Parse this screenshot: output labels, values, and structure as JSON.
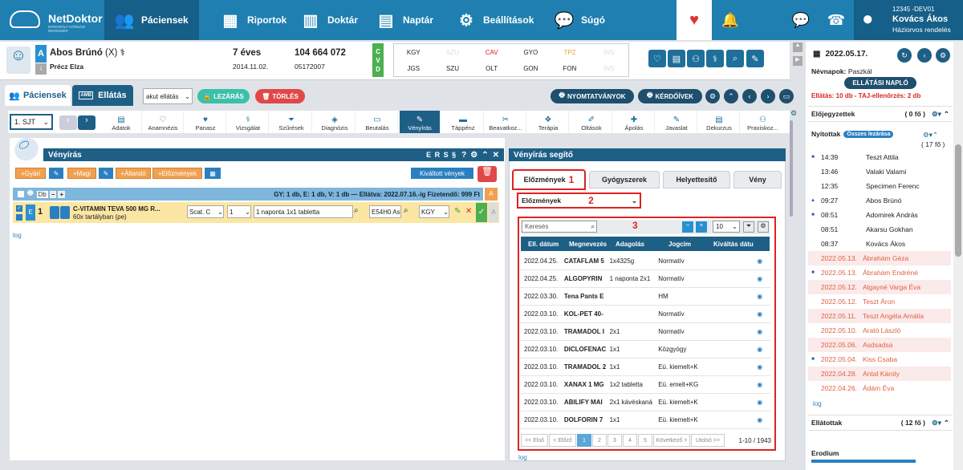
{
  "nav": {
    "logo_name": "NetDoktor",
    "logo_sub": "INTEGRÁLT KÓRHÁZI RENDSZER",
    "items": [
      {
        "label": "Páciensek"
      },
      {
        "label": "Riportok"
      },
      {
        "label": "Doktár"
      },
      {
        "label": "Naptár"
      },
      {
        "label": "Beállítások"
      },
      {
        "label": "Súgó"
      }
    ],
    "user": {
      "code": "12345 -DEV01",
      "name": "Kovács Ákos",
      "role": "Háziorvos rendelés"
    }
  },
  "patient": {
    "letter": "A",
    "name": "Abos Brúnó",
    "suffix": "(X)",
    "mother": "Précz Elza",
    "age": "7 éves",
    "birth": "2014.11.02.",
    "taj": "104 664 072",
    "id": "05172007",
    "cvd": [
      "C",
      "V",
      "D"
    ],
    "codes": [
      "KGY",
      "SZU",
      "CAV",
      "GYO",
      "TPZ",
      "INS",
      "JGS",
      "SZU",
      "OLT",
      "GON",
      "FON",
      "INS"
    ]
  },
  "tabs": {
    "patients": "Páciensek",
    "ellatas": "Ellátás",
    "amb": "AMB",
    "care_select": "akut ellátás",
    "close": "LEZÁRÁS",
    "delete": "TÖRLÉS",
    "print": "NYOMTATVÁNYOK",
    "questionnaires": "KÉRDŐÍVEK"
  },
  "modules": {
    "sjt": "1. SJT",
    "items": [
      "Adatok",
      "Anamnézis",
      "Panasz",
      "Vizsgálat",
      "Szűrések",
      "Diagnózis",
      "Beutalás",
      "Vényírás",
      "Táppénz",
      "Beavatkoz...",
      "Terápia",
      "Oltások",
      "Ápolás",
      "Javaslat",
      "Dekurzus",
      "Praxiskoz..."
    ]
  },
  "prescription": {
    "title": "Vényírás",
    "header_icons": "E   R   S   §",
    "buttons": [
      "+Gyári",
      "+Magi",
      "+Állandó",
      "+Előzmények"
    ],
    "issued": "Kiváltott vények",
    "summary": "GY: 1 db,  E: 1 db,  V: 1 db  —  Ellátva: 2022.07.16.-ig  Fizetendő: 999 Ft",
    "db": "Db",
    "row": {
      "num": "1",
      "name": "C-VITAMIN TEVA 500 MG R...",
      "pack": "60x tartályban (pe)",
      "category": "Scat. C",
      "qty": "1",
      "dose": "1 naponta 1x1 tabletta",
      "bno": "E54H0 As",
      "support": "KGY"
    },
    "log": "log"
  },
  "helper": {
    "title": "Vényírás segítő",
    "tabs": [
      "Előzmények",
      "Gyógyszerek",
      "Helyettesítő",
      "Vény"
    ],
    "select": "Előzmények",
    "marks": [
      "1",
      "2",
      "3"
    ],
    "search_placeholder": "Keresés",
    "per_page": "10",
    "columns": [
      "Ell. dátum",
      "Megnevezés",
      "Adagolás",
      "Jogcím",
      "Kiváltás dátu"
    ],
    "rows": [
      [
        "2022.04.25.",
        "CATAFLAM 5",
        "1x4325g",
        "Normatív"
      ],
      [
        "2022.04.25.",
        "ALGOPYRIN",
        "1 naponta 2x1",
        "Normatív"
      ],
      [
        "2022.03.30.",
        "Tena Pants E",
        "",
        "HM"
      ],
      [
        "2022.03.10.",
        "KOL-PET 40-",
        "",
        "Normatív"
      ],
      [
        "2022.03.10.",
        "TRAMADOL I",
        "2x1",
        "Normatív"
      ],
      [
        "2022.03.10.",
        "DICLOFENAC",
        "1x1",
        "Közgyógy"
      ],
      [
        "2022.03.10.",
        "TRAMADOL 2",
        "1x1",
        "Eü. kiemelt+K"
      ],
      [
        "2022.03.10.",
        "XANAX 1 MG",
        "1x2 tabletta",
        "Eü. emelt+KG"
      ],
      [
        "2022.03.10.",
        "ABILIFY MAI",
        "2x1 kávéskaná",
        "Eü. kiemelt+K"
      ],
      [
        "2022.03.10.",
        "DOLFORIN 7",
        "1x1",
        "Eü. kiemelt+K"
      ]
    ],
    "pager": {
      "first": "<< Első",
      "prev": "< Előző",
      "pages": [
        "1",
        "2",
        "3",
        "4",
        "5"
      ],
      "next": "Következő >",
      "last": "Utolsó >>",
      "range": "1-10 / 1943"
    },
    "log": "log"
  },
  "sidebar": {
    "date": "2022.05.17.",
    "nameday_label": "Névnapok:",
    "nameday": "Paszkál",
    "naplo": "ELLÁTÁSI NAPLÓ",
    "alert": "Ellátás: 10 db - TAJ-ellenőrzés: 2 db",
    "elojegyzett": {
      "title": "Előjegyzettek",
      "count": "( 0 fő )"
    },
    "nyitottak": {
      "title": "Nyitottak",
      "close_all": "Összes lezárása",
      "count": "( 17 fő )"
    },
    "entries": [
      [
        "14:39",
        "Teszt Attila"
      ],
      [
        "13:46",
        "Valaki Valami"
      ],
      [
        "12:35",
        "Specimen Ferenc"
      ],
      [
        "09:27",
        "Abos Brúnó"
      ],
      [
        "08:51",
        "Adomirek András"
      ],
      [
        "08:51",
        "Akarsu Gokhan"
      ],
      [
        "08:37",
        "Kovács Ákos"
      ],
      [
        "2022.05.13.",
        "Ábrahám Géza"
      ],
      [
        "2022.05.13.",
        "Ábrahám Endréné"
      ],
      [
        "2022.05.12.",
        "Algayné Varga Éva"
      ],
      [
        "2022.05.12.",
        "Teszt Áron"
      ],
      [
        "2022.05.11.",
        "Teszt Angéla Amália"
      ],
      [
        "2022.05.10.",
        "Arató László"
      ],
      [
        "2022.05.06.",
        "Asdsadsa"
      ],
      [
        "2022.05.04.",
        "Kiss Csaba"
      ],
      [
        "2022.04.28.",
        "Antal Károly"
      ],
      [
        "2022.04.26.",
        "Ádám Éva"
      ]
    ],
    "log": "log",
    "ellatottak": {
      "title": "Ellátottak",
      "count": "( 12 fő )"
    },
    "erodium": "Erodium"
  },
  "colors": {
    "nav": "#1e7fb0",
    "active": "#155f88",
    "header": "#1e5f86",
    "red": "#d22222"
  }
}
